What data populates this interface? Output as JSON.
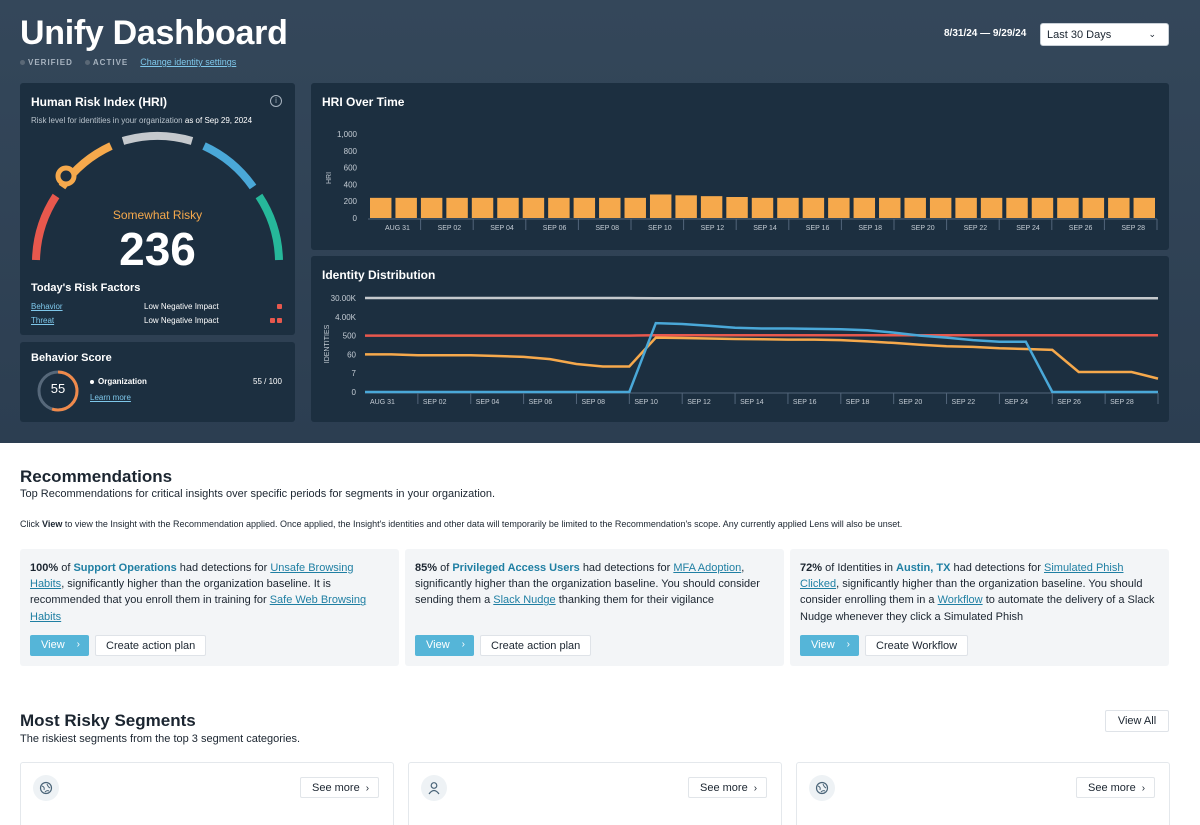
{
  "header": {
    "title": "Unify Dashboard",
    "status_verified": "VERIFIED",
    "status_active": "ACTIVE",
    "change_link": "Change identity settings",
    "date_range": "8/31/24 — 9/29/24",
    "range_select": "Last 30 Days"
  },
  "hri_card": {
    "title": "Human Risk Index (HRI)",
    "subtitle_prefix": "Risk level for identities in your organization",
    "subtitle_date": "as of Sep 29, 2024",
    "risk_label": "Somewhat Risky",
    "score": "236",
    "factors_title": "Today's Risk Factors",
    "factors": [
      {
        "name": "Behavior",
        "impact": "Low Negative Impact",
        "squares": 1
      },
      {
        "name": "Threat",
        "impact": "Low Negative Impact",
        "squares": 2
      }
    ]
  },
  "behavior_card": {
    "title": "Behavior Score",
    "score": "55",
    "score_fraction": 0.55,
    "org_label": "Organization",
    "org_score": "55 / 100",
    "learn_more": "Learn more"
  },
  "colors": {
    "orange": "#f6a94c",
    "red": "#e8584d",
    "blue": "#4aa8d8",
    "gray": "#c5c9cd",
    "gauge_green": "#26b89a"
  },
  "chart_data": [
    {
      "type": "bar",
      "title": "HRI Over Time",
      "ylabel": "HRI",
      "ylim": [
        0,
        1000
      ],
      "yticks": [
        "1,000",
        "800",
        "600",
        "400",
        "200",
        "0"
      ],
      "x_tick_labels": [
        "AUG 31",
        "SEP 02",
        "SEP 04",
        "SEP 06",
        "SEP 08",
        "SEP 10",
        "SEP 12",
        "SEP 14",
        "SEP 16",
        "SEP 18",
        "SEP 20",
        "SEP 22",
        "SEP 24",
        "SEP 26",
        "SEP 28"
      ],
      "values": [
        240,
        240,
        240,
        240,
        240,
        240,
        240,
        240,
        240,
        240,
        240,
        280,
        270,
        260,
        250,
        240,
        240,
        240,
        240,
        240,
        240,
        240,
        240,
        240,
        240,
        240,
        240,
        240,
        240,
        240,
        240
      ],
      "color": "#f6a94c"
    },
    {
      "type": "line",
      "title": "Identity Distribution",
      "ylabel": "IDENTITIES",
      "yticks": [
        "30.00K",
        "4.00K",
        "500",
        "60",
        "7",
        "0"
      ],
      "x_tick_labels": [
        "AUG 31",
        "SEP 02",
        "SEP 04",
        "SEP 06",
        "SEP 08",
        "SEP 10",
        "SEP 12",
        "SEP 14",
        "SEP 16",
        "SEP 18",
        "SEP 20",
        "SEP 22",
        "SEP 24",
        "SEP 26",
        "SEP 28"
      ],
      "series": [
        {
          "color": "#c5c9cd",
          "values": [
            30000,
            30000,
            30000,
            30000,
            30000,
            30000,
            30000,
            30000,
            30000,
            30000,
            30000,
            29000,
            29000,
            29000,
            29000,
            29000,
            29000,
            29000,
            29000,
            29000,
            29000,
            29000,
            29000,
            29000,
            29000,
            29000,
            29000,
            29000,
            29000,
            29000,
            29000
          ]
        },
        {
          "color": "#e8584d",
          "values": [
            500,
            500,
            500,
            500,
            500,
            500,
            500,
            500,
            500,
            500,
            500,
            520,
            520,
            520,
            520,
            520,
            520,
            520,
            520,
            520,
            520,
            520,
            520,
            520,
            520,
            520,
            520,
            520,
            520,
            520,
            520
          ]
        },
        {
          "color": "#f6a94c",
          "values": [
            60,
            60,
            55,
            55,
            55,
            50,
            45,
            35,
            20,
            15,
            15,
            400,
            380,
            360,
            340,
            330,
            320,
            320,
            300,
            260,
            220,
            180,
            150,
            140,
            120,
            110,
            100,
            8,
            8,
            8,
            5
          ]
        },
        {
          "color": "#4aa8d8",
          "values": [
            0,
            0,
            0,
            0,
            0,
            0,
            0,
            0,
            0,
            0,
            0,
            2000,
            1800,
            1500,
            1200,
            1100,
            1100,
            1050,
            1000,
            900,
            700,
            500,
            400,
            300,
            250,
            250,
            0,
            0,
            0,
            0,
            0
          ]
        }
      ]
    }
  ],
  "recommendations": {
    "title": "Recommendations",
    "subtitle": "Top Recommendations for critical insights over specific periods for segments in your organization.",
    "note_prefix": "Click",
    "note_bold": "View",
    "note_rest": "to view the Insight with the Recommendation applied. Once applied, the Insight's identities and other data will temporarily be limited to the Recommendation's scope. Any currently applied Lens will also be unset.",
    "cards": [
      {
        "pct": "100%",
        "of": "of",
        "segment": "Support Operations",
        "had": "had detections for",
        "detection": "Unsafe Browsing Habits",
        "body": ", significantly higher than the organization baseline. It is recommended that you enroll them in training for",
        "action": "Safe Web Browsing Habits",
        "tail": "",
        "view": "View",
        "secondary": "Create action plan"
      },
      {
        "pct": "85%",
        "of": "of",
        "segment": "Privileged Access Users",
        "had": "had detections for",
        "detection": "MFA Adoption",
        "body": ", significantly higher than the organization baseline. You should consider sending them a",
        "action": "Slack Nudge",
        "tail": "thanking them for their vigilance",
        "view": "View",
        "secondary": "Create action plan"
      },
      {
        "pct": "72%",
        "of": "of Identities in",
        "segment": "Austin, TX",
        "had": "had detections for",
        "detection": "Simulated Phish Clicked",
        "body": ", significantly higher than the organization baseline. You should consider enrolling them in a",
        "action": "Workflow",
        "tail": "to automate the delivery of a Slack Nudge whenever they click a Simulated Phish",
        "view": "View",
        "secondary": "Create Workflow"
      }
    ]
  },
  "segments": {
    "title": "Most Risky Segments",
    "subtitle": "The riskiest segments from the top 3 segment categories.",
    "view_all": "View All",
    "cards": [
      {
        "icon": "globe-icon",
        "see_more": "See more"
      },
      {
        "icon": "user-icon",
        "see_more": "See more"
      },
      {
        "icon": "globe-icon",
        "see_more": "See more"
      }
    ]
  }
}
